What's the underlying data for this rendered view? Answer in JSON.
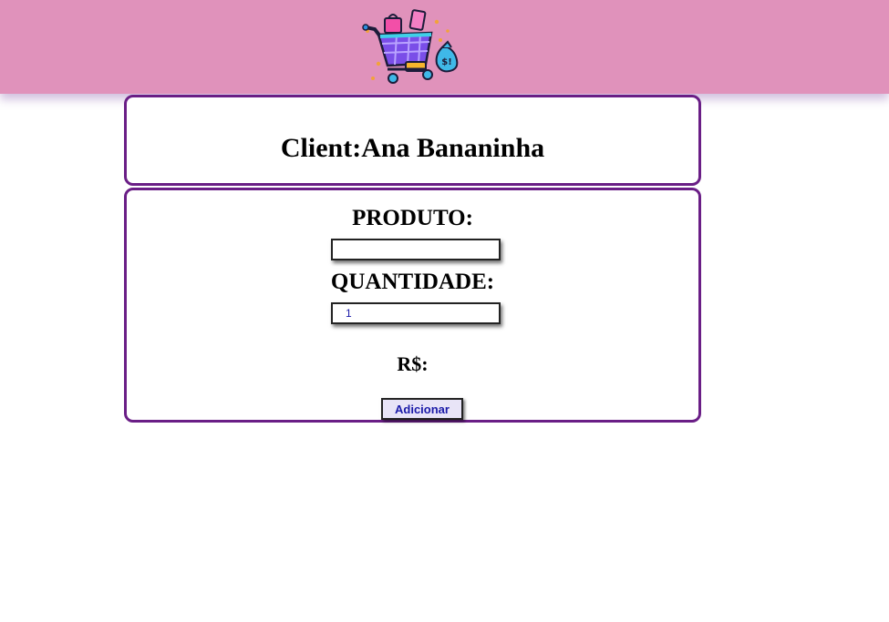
{
  "header": {
    "logo_icon": "shopping-cart-icon",
    "colors": {
      "background": "#e092bb",
      "accent": "#6a1e86"
    }
  },
  "client": {
    "title": "Client:Ana Bananinha"
  },
  "form": {
    "produto_label": "PRODUTO:",
    "produto_value": "",
    "quantidade_label": "QUANTIDADE:",
    "quantidade_value": "1",
    "preco_label": "R$:",
    "preco_value": "",
    "add_button_label": "Adicionar"
  }
}
